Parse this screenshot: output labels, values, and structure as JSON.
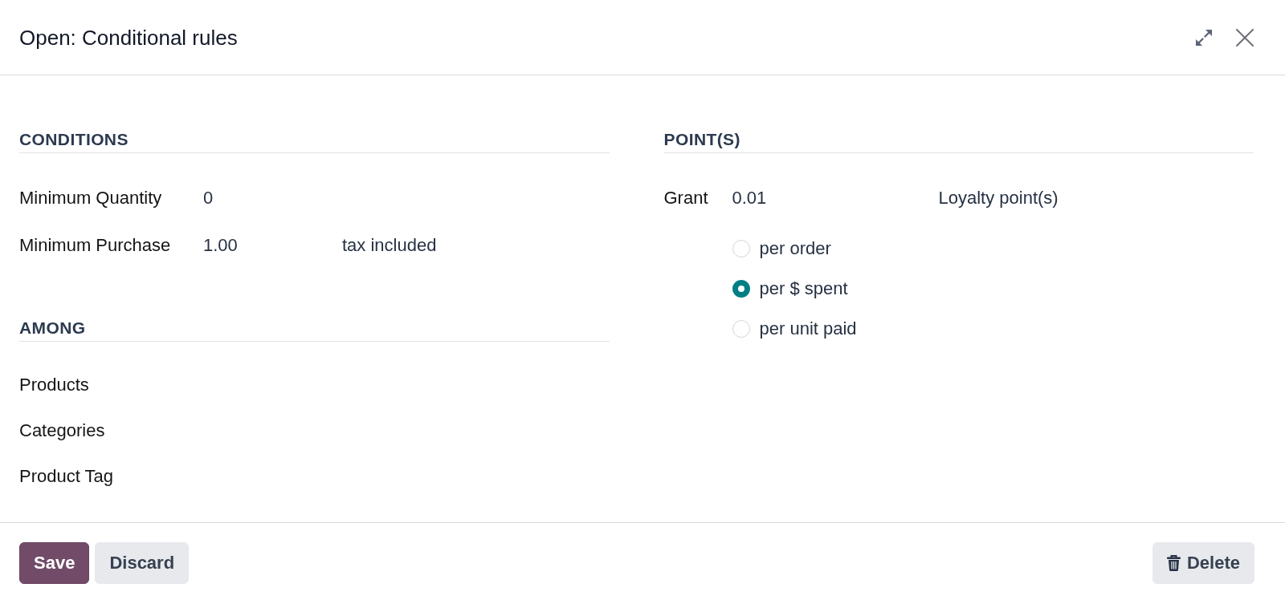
{
  "dialog": {
    "title": "Open: Conditional rules"
  },
  "conditions": {
    "heading": "CONDITIONS",
    "fields": [
      {
        "label": "Minimum Quantity",
        "value": "0"
      },
      {
        "label": "Minimum Purchase",
        "value": "1.00",
        "suffix": "tax included"
      }
    ]
  },
  "among": {
    "heading": "AMONG",
    "fields": [
      {
        "label": "Products"
      },
      {
        "label": "Categories"
      },
      {
        "label": "Product Tag"
      }
    ]
  },
  "points": {
    "heading": "POINT(S)",
    "grant": {
      "label": "Grant",
      "value": "0.01",
      "unit": "Loyalty point(s)"
    },
    "modes": [
      {
        "label": "per order",
        "selected": false
      },
      {
        "label": "per $ spent",
        "selected": true
      },
      {
        "label": "per unit paid",
        "selected": false
      }
    ]
  },
  "footer": {
    "buttons": [
      {
        "label": "Save",
        "kind": "primary"
      },
      {
        "label": "Discard",
        "kind": "secondary"
      },
      {
        "label": "Delete",
        "kind": "delete"
      }
    ]
  }
}
